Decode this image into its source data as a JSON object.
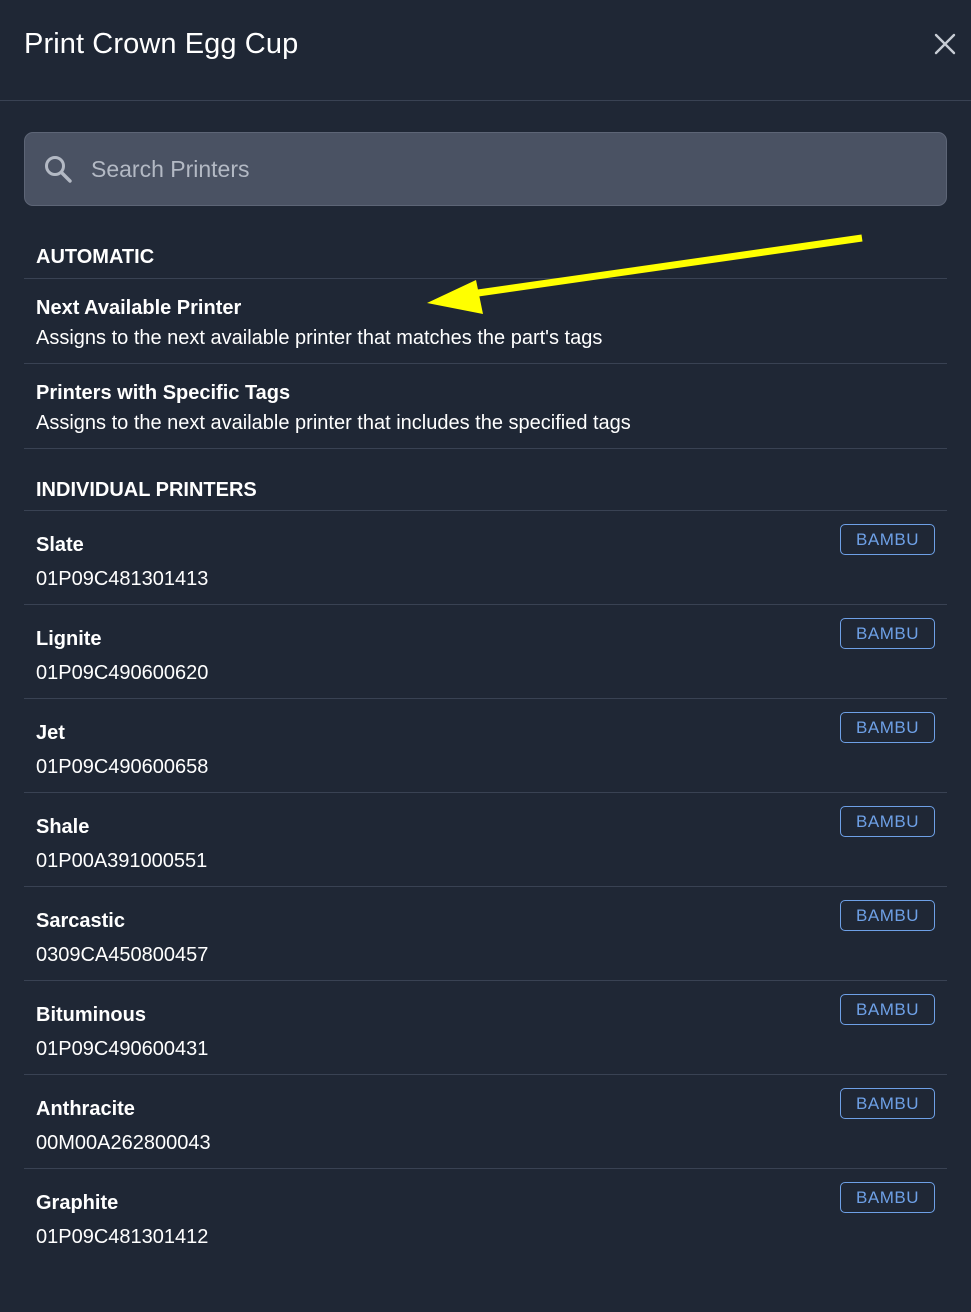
{
  "modal": {
    "title": "Print Crown Egg Cup",
    "close_icon": "close-icon"
  },
  "search": {
    "icon": "search-icon",
    "placeholder": "Search Printers",
    "value": ""
  },
  "automatic": {
    "header": "AUTOMATIC",
    "items": [
      {
        "title": "Next Available Printer",
        "description": "Assigns to the next available printer that matches the part's tags"
      },
      {
        "title": "Printers with Specific Tags",
        "description": "Assigns to the next available printer that includes the specified tags"
      }
    ]
  },
  "individual": {
    "header": "INDIVIDUAL PRINTERS",
    "printers": [
      {
        "name": "Slate",
        "serial": "01P09C481301413",
        "tag": "BAMBU"
      },
      {
        "name": "Lignite",
        "serial": "01P09C490600620",
        "tag": "BAMBU"
      },
      {
        "name": "Jet",
        "serial": "01P09C490600658",
        "tag": "BAMBU"
      },
      {
        "name": "Shale",
        "serial": "01P00A391000551",
        "tag": "BAMBU"
      },
      {
        "name": "Sarcastic",
        "serial": "0309CA450800457",
        "tag": "BAMBU"
      },
      {
        "name": "Bituminous",
        "serial": "01P09C490600431",
        "tag": "BAMBU"
      },
      {
        "name": "Anthracite",
        "serial": "00M00A262800043",
        "tag": "BAMBU"
      },
      {
        "name": "Graphite",
        "serial": "01P09C481301412",
        "tag": "BAMBU"
      }
    ]
  },
  "annotation": {
    "icon": "yellow-arrow-annotation",
    "color": "#ffff00"
  },
  "colors": {
    "background": "#1f2735",
    "divider": "#394253",
    "search_bg": "#4a5263",
    "tag_accent": "#6ea0e6"
  }
}
